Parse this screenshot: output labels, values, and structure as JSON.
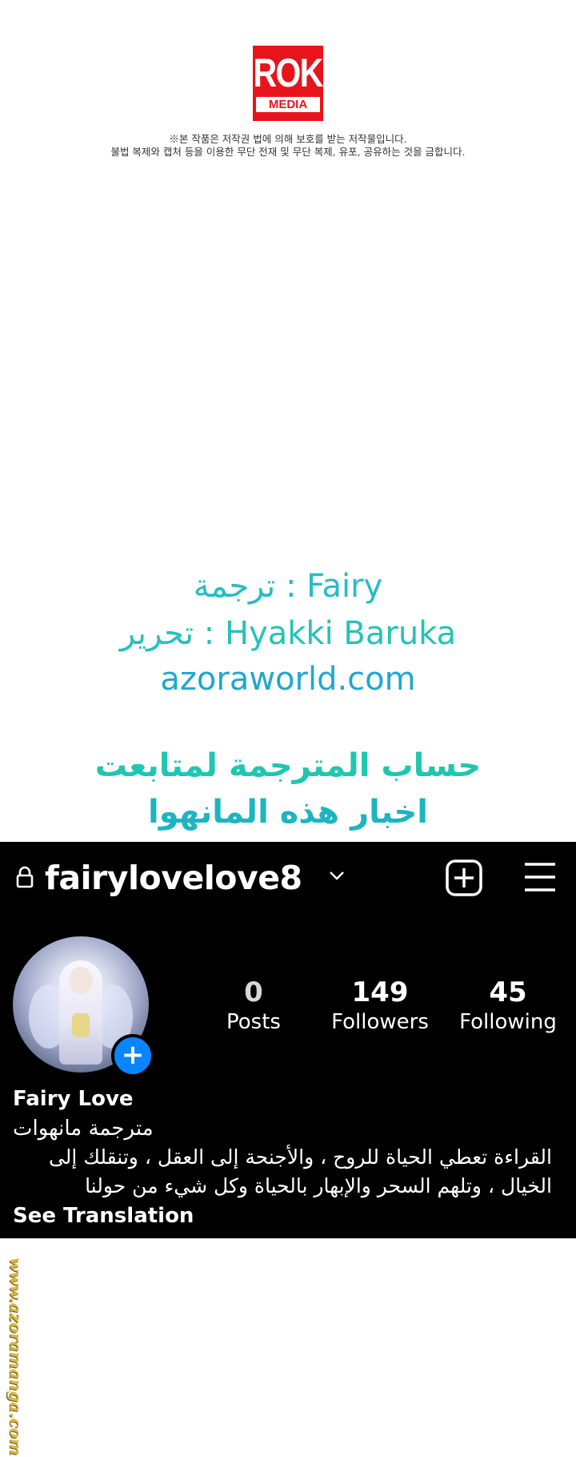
{
  "logo": {
    "main": "ROK",
    "sub": "MEDIA",
    "color": "#e8141b"
  },
  "copyright": {
    "line1": "※본 작품은 저작권 법에 의해 보호를 받는 저작물입니다.",
    "line2": "불법 복제와 캡처 등을 이용한 무단 전재 및 무단 복제, 유포, 공유하는 것을 금합니다."
  },
  "credits": {
    "translation": "ترجمة : Fairy",
    "editing": "تحرير : Hyakki Baruka",
    "site": "azoraworld.com",
    "follow_line1": "حساب المترجمة لمتابعت",
    "follow_line2": "اخبار هذه المانهوا"
  },
  "instagram": {
    "username": "fairylovelove8",
    "icons": {
      "lock": "lock-icon",
      "chevron": "chevron-down-icon",
      "create": "plus-square-icon",
      "menu": "hamburger-menu-icon",
      "add_story": "plus-icon"
    },
    "stats": {
      "posts": {
        "value": "0",
        "label": "Posts"
      },
      "followers": {
        "value": "149",
        "label": "Followers"
      },
      "following": {
        "value": "45",
        "label": "Following"
      }
    },
    "display_name": "Fairy Love",
    "category": "مترجمة مانهوات",
    "bio_line1": "القراءة تعطي الحياة للروح ، والأجنحة إلى العقل ، وتنقلك إلى",
    "bio_line2": "الخيال ، وتلهم السحر والإبهار بالحياة وكل شيء من حولنا",
    "see_translation": "See Translation",
    "accent": "#0a84ff"
  },
  "watermark": "www.azoramanga.com"
}
